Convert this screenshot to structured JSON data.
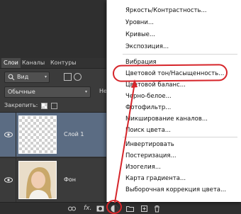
{
  "panel": {
    "tabs": [
      "Слои",
      "Каналы",
      "Контуры"
    ],
    "filter_kind": "Вид",
    "blend_mode": "Обычные",
    "opacity_label": "Непр",
    "lock_label": "Закрепить:",
    "layers": [
      {
        "name": "Слой 1",
        "selected": true,
        "thumbnail": "transparent"
      },
      {
        "name": "Фон",
        "selected": false,
        "thumbnail": "photo-portrait"
      }
    ],
    "bottom_text": "fx."
  },
  "menu": {
    "items": [
      "Яркость/Контрастность...",
      "Уровни...",
      "Кривые...",
      "Экспозиция...",
      "Вибрация",
      "Цветовой тон/Насыщенность...",
      "Цветовой баланс...",
      "Черно-белое...",
      "Фотофильтр...",
      "Микширование каналов...",
      "Поиск цвета...",
      "Инвертировать",
      "Постеризация...",
      "Изогелия...",
      "Карта градиента...",
      "Выборочная коррекция цвета..."
    ],
    "highlighted_item": "Цветовой тон/Насыщенность..."
  },
  "colors": {
    "selected_layer": "#5b6c83",
    "panel_bg": "#3b3b3b",
    "annotation": "#d6252a"
  }
}
